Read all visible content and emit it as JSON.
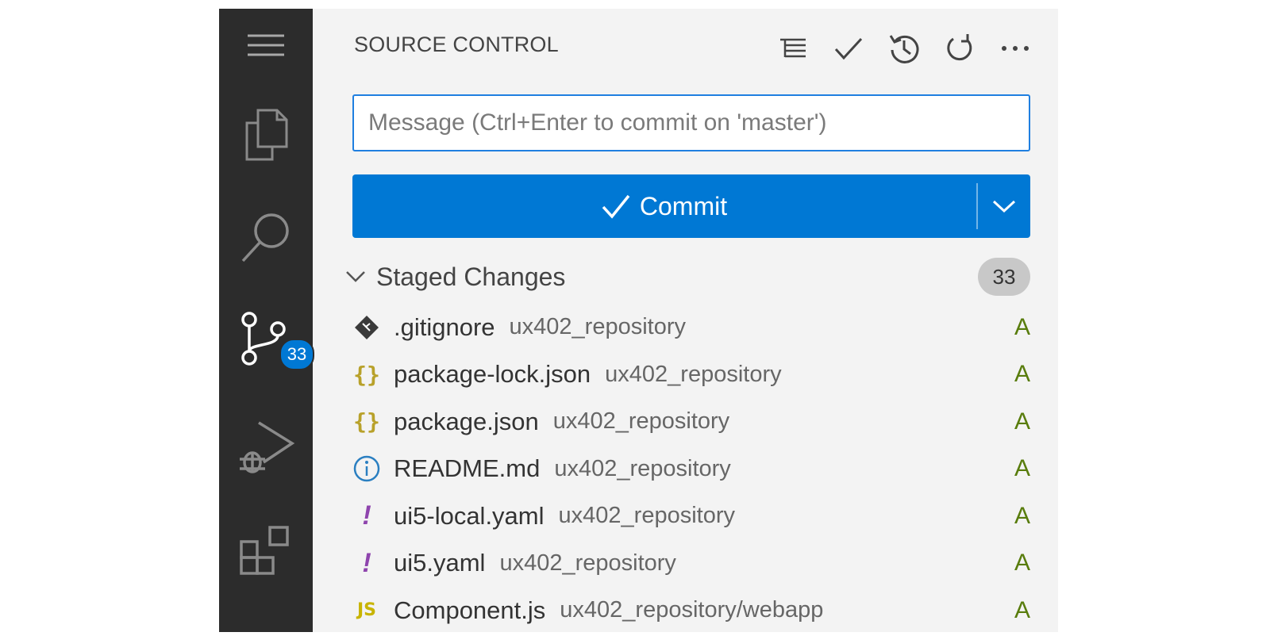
{
  "sidebar": {
    "title": "SOURCE CONTROL",
    "message_placeholder": "Message (Ctrl+Enter to commit on 'master')",
    "commit_label": "Commit",
    "group": {
      "label": "Staged Changes",
      "count": "33"
    },
    "files": [
      {
        "name": ".gitignore",
        "path": "ux402_repository",
        "status": "A",
        "icon": "git-icon"
      },
      {
        "name": "package-lock.json",
        "path": "ux402_repository",
        "status": "A",
        "icon": "json-icon"
      },
      {
        "name": "package.json",
        "path": "ux402_repository",
        "status": "A",
        "icon": "json-icon"
      },
      {
        "name": "README.md",
        "path": "ux402_repository",
        "status": "A",
        "icon": "info-icon"
      },
      {
        "name": "ui5-local.yaml",
        "path": "ux402_repository",
        "status": "A",
        "icon": "yaml-icon"
      },
      {
        "name": "ui5.yaml",
        "path": "ux402_repository",
        "status": "A",
        "icon": "yaml-icon"
      },
      {
        "name": "Component.js",
        "path": "ux402_repository/webapp",
        "status": "A",
        "icon": "js-icon"
      }
    ]
  },
  "activity_bar": {
    "source_control_badge": "33"
  },
  "colors": {
    "accent": "#0078d4",
    "added": "#587c0c",
    "activity_bar_bg": "#2c2c2c"
  }
}
